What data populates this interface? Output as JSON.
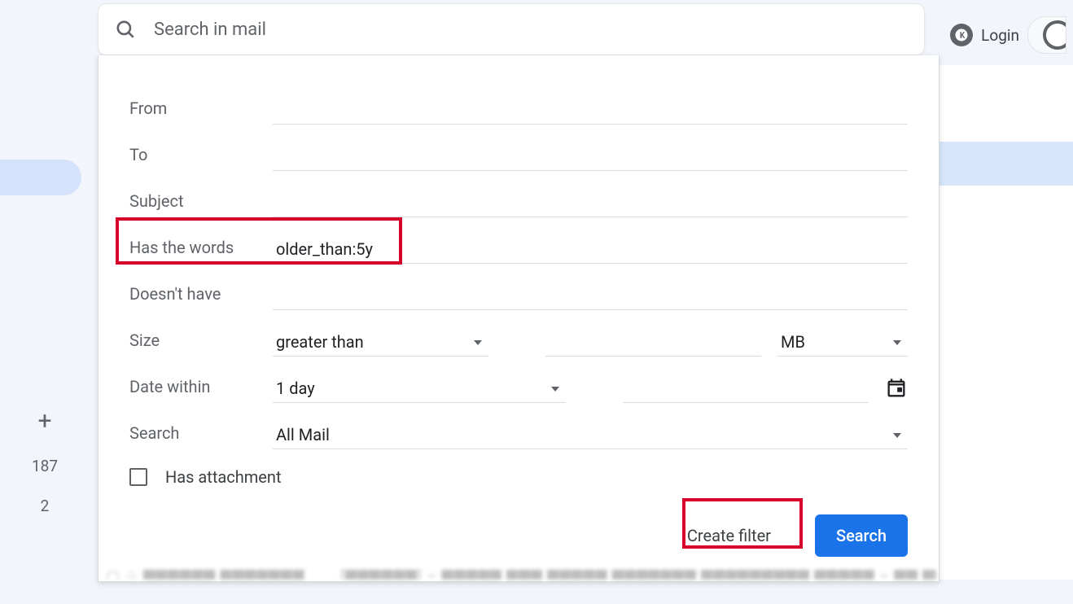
{
  "search": {
    "placeholder": "Search in mail"
  },
  "topRight": {
    "login": "Login"
  },
  "sidebar": {
    "count1": "187",
    "count2": "2"
  },
  "filter": {
    "from_label": "From",
    "to_label": "To",
    "subject_label": "Subject",
    "haswords_label": "Has the words",
    "haswords_value": "older_than:5y",
    "nothave_label": "Doesn't have",
    "size_label": "Size",
    "size_op": "greater than",
    "size_unit": "MB",
    "date_label": "Date within",
    "date_value": "1 day",
    "search_label": "Search",
    "search_value": "All Mail",
    "attach_label": "Has attachment"
  },
  "buttons": {
    "create_filter": "Create filter",
    "search": "Search"
  }
}
